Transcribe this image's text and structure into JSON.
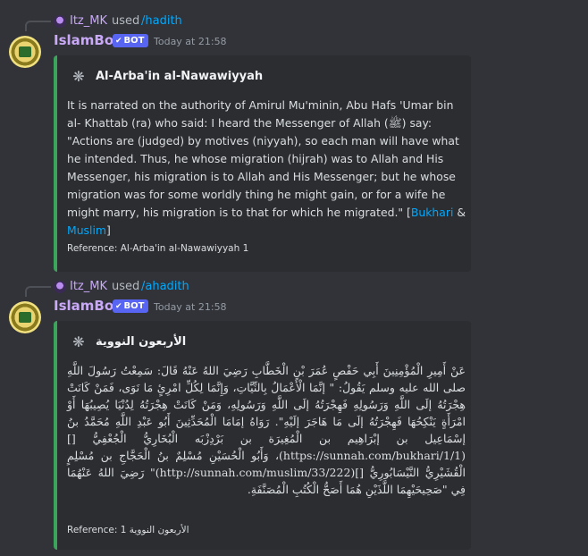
{
  "messages": [
    {
      "reply": {
        "user": "Itz_MK",
        "used": "used",
        "command": "/hadith"
      },
      "author": "IslamBot",
      "badge": "BOT",
      "timestamp": "Today at 21:58",
      "embed": {
        "title": "Al-Arba'in al-Nawawiyyah",
        "body_part1": "It is narrated on the authority of Amirul Mu'minin, Abu Hafs 'Umar bin al- Khattab (ra) who said: I heard the Messenger of Allah (ﷺ) say: \"Actions are (judged) by motives (niyyah), so each man will have what he intended. Thus, he whose migration (hijrah) was to Allah and His Messenger, his migration is to Allah and His Messenger; but he whose migration was for some worldly thing he might gain, or for a wife he might marry, his migration is to that for which he migrated.\" [",
        "link1": "Bukhari",
        "amp": " & ",
        "link2": "Muslim",
        "close": "]",
        "reference": "Reference: Al-Arba'in al-Nawawiyyah 1",
        "accent": "#3ba55c"
      }
    },
    {
      "reply": {
        "user": "Itz_MK",
        "used": "used",
        "command": "/ahadith"
      },
      "author": "IslamBot",
      "badge": "BOT",
      "timestamp": "Today at 21:58",
      "embed": {
        "title": "الأربعون النووية",
        "body": "عَنْ أَمِيرِ الْمُؤْمِنِينَ أَبِي حَفْصٍ عُمَرَ بْنِ الْخَطَّابِ رَضِيَ اللهُ عَنْهُ قَالَ: سَمِعْتُ رَسُولَ اللَّهِ صلى الله عليه وسلم يَقُولُ: \" إنَّمَا الْأَعْمَالُ بِالنِّيَّاتِ، وَإِنَّمَا لِكُلِّ امْرِئٍ مَا نَوَى، فَمَنْ كَانَتْ هِجْرَتُهُ إلَى اللَّهِ وَرَسُولِهِ فَهِجْرَتُهُ إلَى اللَّهِ وَرَسُولِهِ، وَمَنْ كَانَتْ هِجْرَتُهُ لِدُنْيَا يُصِيبُهَا أَوْ امْرَأَةٍ يَنْكِحُهَا فَهِجْرَتُهُ إلَى مَا هَاجَرَ إلَيْهِ\". رَوَاهُ إمَامَا الْمُحَدِّثِينَ أَبُو عَبْدِ اللَّهِ مُحَمَّدُ بنُ إسْمَاعِيل بن إبْرَاهِيم بن الْمُغِيرَة بن بَرْدِزْبَه الْبُخَارِيُّ الْجُعْفِيُّ [](https://sunnah.com/bukhari/1/1)، وَأَبُو الْحُسَيْنِ مُسْلِمٌ بنُ الْحَجَّاجِ بن مُسْلِمٍ الْقُشَيْرِيُّ النَّيْسَابُورِيُّ [](http://sunnah.com/muslim/33/222)\" رَضِيَ اللهُ عَنْهُمَا فِي \"صَحِيحَيْهِمَا اللَّذَيْنِ هُمَا أَصَحُّ الْكُتُبِ الْمُصَنَّفَةِ.",
        "reference": "Reference: الأربعون النووية 1",
        "accent": "#3ba55c"
      }
    }
  ]
}
